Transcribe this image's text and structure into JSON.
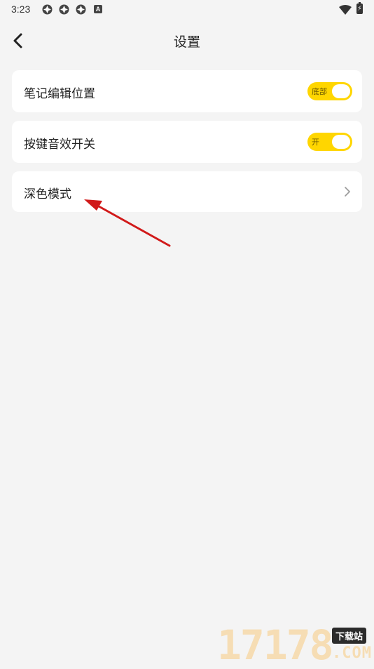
{
  "status_bar": {
    "time": "3:23",
    "notification_icons": [
      "app-notification-icon",
      "app-notification-icon",
      "app-notification-icon"
    ],
    "a_badge": "A"
  },
  "header": {
    "title": "设置"
  },
  "settings": {
    "items": [
      {
        "label": "笔记编辑位置",
        "control": "toggle",
        "toggle_text": "底部",
        "on": true
      },
      {
        "label": "按键音效开关",
        "control": "toggle",
        "toggle_text": "开",
        "on": true
      },
      {
        "label": "深色模式",
        "control": "chevron"
      }
    ]
  },
  "colors": {
    "background": "#f4f4f4",
    "card": "#ffffff",
    "toggle_on": "#ffd600",
    "annotation_arrow": "#d11a1a"
  },
  "watermark": {
    "number": "17178",
    "badge": "下载站",
    "suffix": ".COM"
  }
}
